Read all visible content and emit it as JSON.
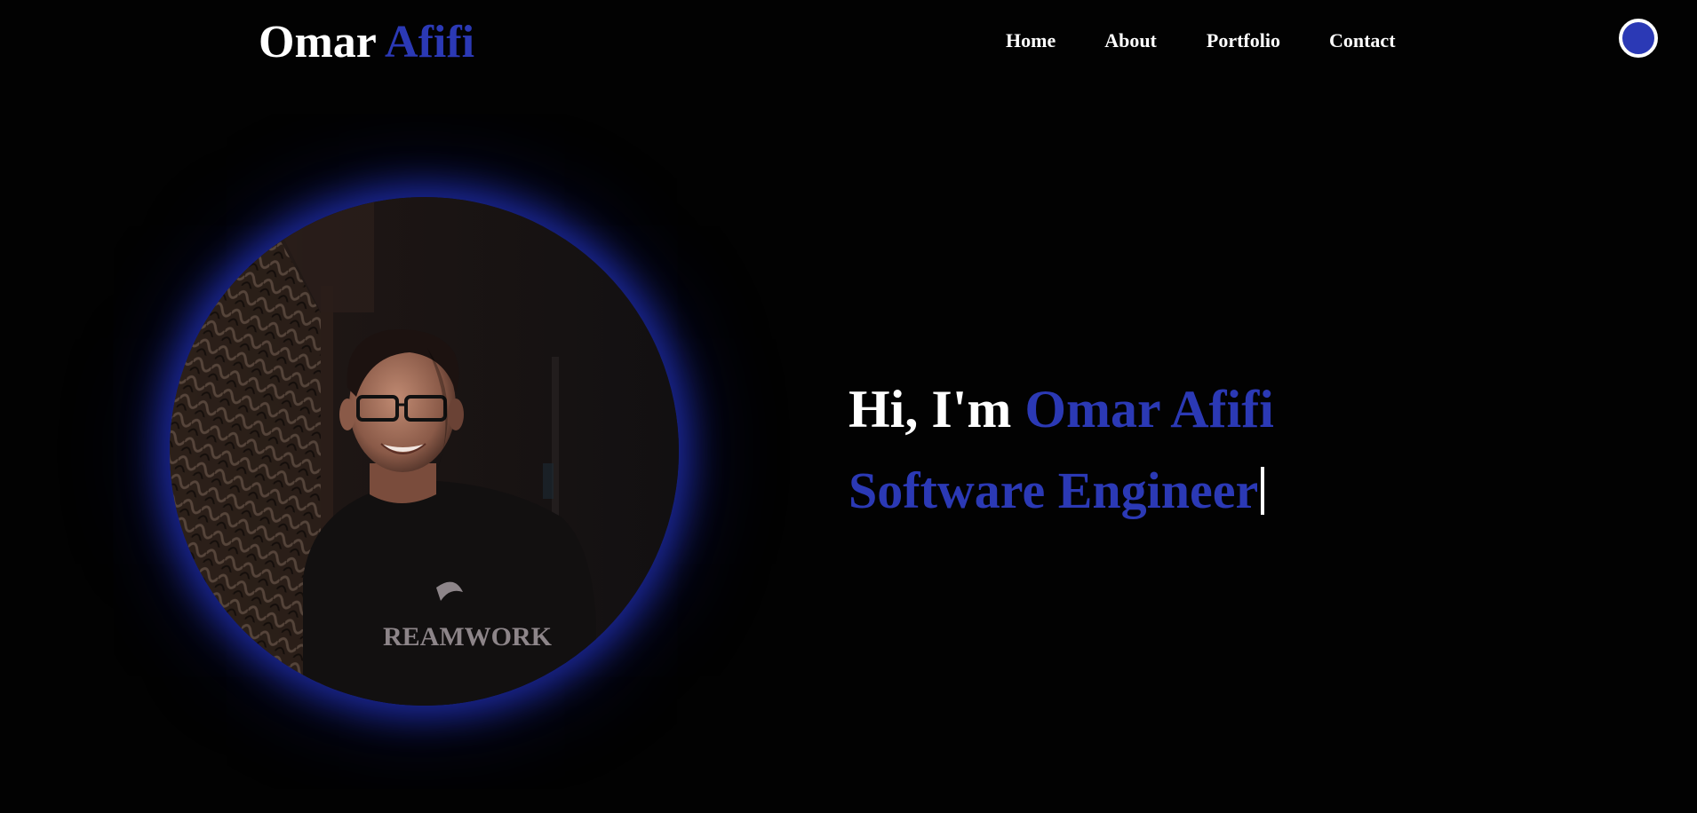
{
  "header": {
    "brand_first": "Omar",
    "brand_last": "Afifi",
    "nav": {
      "home": "Home",
      "about": "About",
      "portfolio": "Portfolio",
      "contact": "Contact"
    },
    "theme_toggle_icon": "circle-toggle-icon"
  },
  "hero": {
    "greeting": "Hi, I'm",
    "name": "Omar Afifi",
    "role": "Software Engineer",
    "photo_shirt_text": "REAMWORK"
  },
  "colors": {
    "background": "#020202",
    "accent": "#2b39b5",
    "text": "#ffffff",
    "glow": "#1e2daa"
  }
}
